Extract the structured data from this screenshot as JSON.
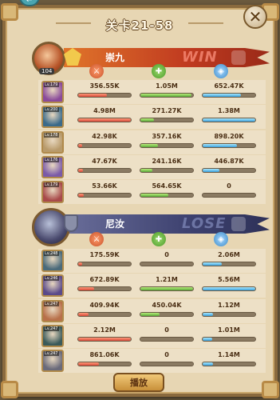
{
  "title": "关卡21-58",
  "play_label": "播放",
  "icons": [
    "damage-icon",
    "heal-icon",
    "shield-icon"
  ],
  "team1": {
    "name": "崇九",
    "result": "WIN",
    "hero_level": "104",
    "units": [
      {
        "lv": "Lv.179",
        "dmg": "356.55K",
        "heal": "1.05M",
        "def": "652.47K",
        "dmg_pct": 0.55,
        "heal_pct": 0.97,
        "def_pct": 0.73
      },
      {
        "lv": "Lv.200",
        "dmg": "4.98M",
        "heal": "271.27K",
        "def": "1.38M",
        "dmg_pct": 1.0,
        "heal_pct": 0.26,
        "def_pct": 1.0
      },
      {
        "lv": "Lv.178",
        "dmg": "42.98K",
        "heal": "357.16K",
        "def": "898.20K",
        "dmg_pct": 0.08,
        "heal_pct": 0.34,
        "def_pct": 0.65
      },
      {
        "lv": "Lv.176",
        "dmg": "47.67K",
        "heal": "241.16K",
        "def": "446.87K",
        "dmg_pct": 0.09,
        "heal_pct": 0.23,
        "def_pct": 0.32
      },
      {
        "lv": "Lv.179",
        "dmg": "53.66K",
        "heal": "564.65K",
        "def": "0",
        "dmg_pct": 0.1,
        "heal_pct": 0.53,
        "def_pct": 0.0
      }
    ]
  },
  "team2": {
    "name": "尼汝",
    "result": "LOSE",
    "units": [
      {
        "lv": "Lv.248",
        "dmg": "175.59K",
        "heal": "0",
        "def": "2.06M",
        "dmg_pct": 0.08,
        "heal_pct": 0.0,
        "def_pct": 0.37
      },
      {
        "lv": "Lv.246",
        "dmg": "672.89K",
        "heal": "1.21M",
        "def": "5.56M",
        "dmg_pct": 0.31,
        "heal_pct": 1.0,
        "def_pct": 1.0
      },
      {
        "lv": "Lv.247",
        "dmg": "409.94K",
        "heal": "450.04K",
        "def": "1.12M",
        "dmg_pct": 0.19,
        "heal_pct": 0.37,
        "def_pct": 0.2
      },
      {
        "lv": "Lv.247",
        "dmg": "2.12M",
        "heal": "0",
        "def": "1.01M",
        "dmg_pct": 1.0,
        "heal_pct": 0.0,
        "def_pct": 0.18
      },
      {
        "lv": "Lv.247",
        "dmg": "861.06K",
        "heal": "0",
        "def": "1.14M",
        "dmg_pct": 0.4,
        "heal_pct": 0.0,
        "def_pct": 0.2
      }
    ]
  }
}
